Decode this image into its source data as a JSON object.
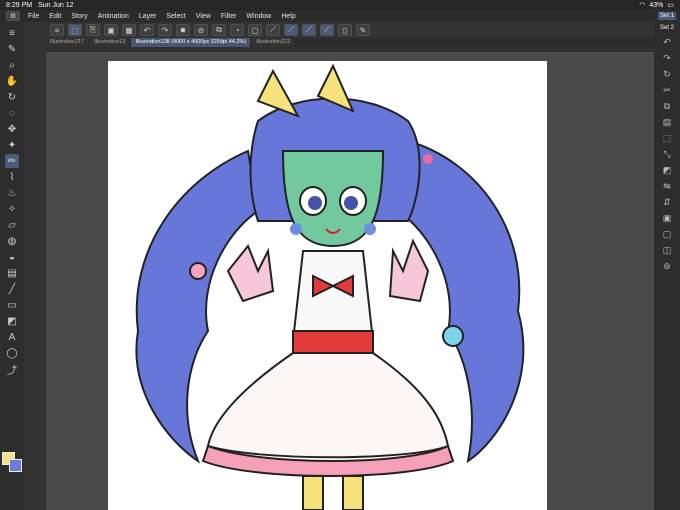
{
  "status": {
    "time": "8:29 PM",
    "date": "Sun Jun 12",
    "battery": "43%"
  },
  "menu": [
    "File",
    "Edit",
    "Story",
    "Animation",
    "Layer",
    "Select",
    "View",
    "Filter",
    "Window",
    "Help"
  ],
  "tabs": [
    {
      "label": "Illustration217",
      "active": false
    },
    {
      "label": "Illustration23",
      "active": false
    },
    {
      "label": "Illustration138 (4000 x 4000px 326dpi 44.2%)",
      "active": true
    },
    {
      "label": "Illustration222",
      "active": false
    }
  ],
  "right_sets": [
    "Set 1",
    "Set 2"
  ],
  "colors": {
    "main": "#f3e28a",
    "sub": "#6a7bd8",
    "accent": "#4b5b7a"
  }
}
